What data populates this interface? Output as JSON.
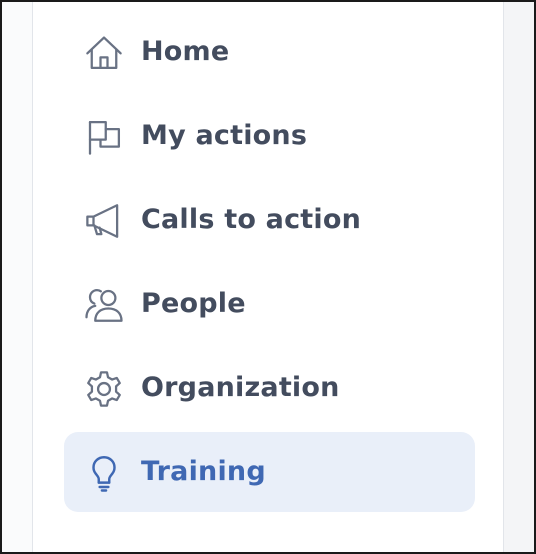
{
  "nav": {
    "items": [
      {
        "label": "Home",
        "icon": "home-icon",
        "active": false
      },
      {
        "label": "My actions",
        "icon": "flag-icon",
        "active": false
      },
      {
        "label": "Calls to action",
        "icon": "megaphone-icon",
        "active": false
      },
      {
        "label": "People",
        "icon": "people-icon",
        "active": false
      },
      {
        "label": "Organization",
        "icon": "gear-icon",
        "active": false
      },
      {
        "label": "Training",
        "icon": "lightbulb-icon",
        "active": true
      }
    ]
  },
  "colors": {
    "text": "#434c5e",
    "icon": "#697284",
    "active_text": "#3f68b3",
    "active_bg": "#e9eff9"
  }
}
